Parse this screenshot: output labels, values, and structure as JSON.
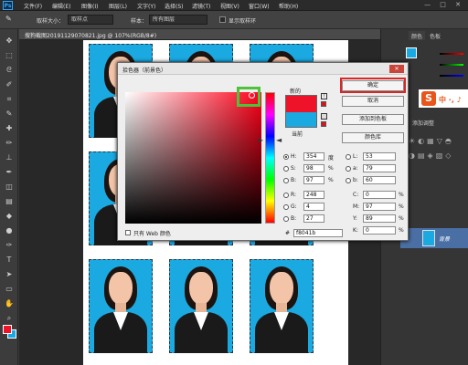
{
  "app": {
    "logo": "Ps"
  },
  "menubar": {
    "items": [
      "文件(F)",
      "编辑(E)",
      "图像(I)",
      "图层(L)",
      "文字(Y)",
      "选择(S)",
      "滤镜(T)",
      "视图(V)",
      "窗口(W)",
      "帮助(H)"
    ],
    "window_controls": "— □ ✕"
  },
  "options": {
    "sample_size_label": "取样大小：",
    "sample_size_value": "取样点",
    "sample_label": "样本：",
    "sample_value": "所有图层",
    "show_ring_label": "显示取样环"
  },
  "document": {
    "tab_title": "搜狗截图20191129070821.jpg @ 107%(RGB/8#)"
  },
  "panels": {
    "color_tab": "颜色",
    "swatches_tab": "色板",
    "adjust_label": "添加调整",
    "layer_name": "背景"
  },
  "logo": {
    "mark": "S",
    "text": "中 ·, ♪"
  },
  "dialog": {
    "title": "拾色器（前景色）",
    "new_label": "新的",
    "current_label": "当前",
    "new_color": "#ef1329",
    "current_color": "#1ba9e1",
    "buttons": {
      "ok": "确定",
      "cancel": "取消",
      "add_swatch": "添加到色板",
      "libraries": "颜色库"
    },
    "hsb": {
      "h_label": "H:",
      "h": "354",
      "h_unit": "度",
      "s_label": "S:",
      "s": "98",
      "s_unit": "%",
      "b_label": "B:",
      "b": "97",
      "b_unit": "%"
    },
    "lab": {
      "l_label": "L:",
      "l": "53",
      "a_label": "a:",
      "a": "79",
      "b_label": "b:",
      "b": "60"
    },
    "rgb": {
      "r_label": "R:",
      "r": "248",
      "g_label": "G:",
      "g": "4",
      "b_label": "B:",
      "b": "27"
    },
    "cmyk": {
      "c_label": "C:",
      "c": "0",
      "c_unit": "%",
      "m_label": "M:",
      "m": "97",
      "m_unit": "%",
      "y_label": "Y:",
      "y": "89",
      "y_unit": "%",
      "k_label": "K:",
      "k": "0",
      "k_unit": "%"
    },
    "hex_label": "#",
    "hex": "f8041b",
    "web_only_label": "只有 Web 颜色"
  }
}
